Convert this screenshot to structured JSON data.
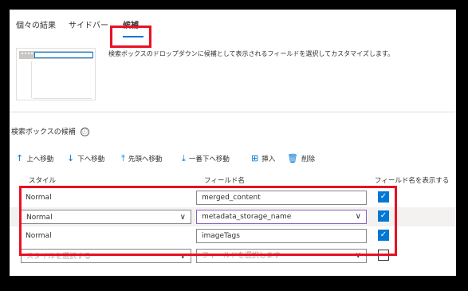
{
  "tabs": [
    "個々の結果",
    "サイドバー",
    "候補"
  ],
  "description": "検索ボックスのドロップダウンに候補として表示されるフィールドを選択してカスタマイズします。",
  "section_title": "検索ボックスの候補",
  "info_icon": "ⓘ",
  "toolbar": [
    {
      "icon": "↑",
      "label": "上へ移動",
      "icon_name": "arrow-up-icon"
    },
    {
      "icon": "↓",
      "label": "下へ移動",
      "icon_name": "arrow-down-icon"
    },
    {
      "icon": "⤒",
      "label": "先頭へ移動",
      "icon_name": "move-to-top-icon"
    },
    {
      "icon": "⤓",
      "label": "一番下へ移動",
      "icon_name": "move-to-bottom-icon"
    },
    {
      "icon": "⊞",
      "label": "挿入",
      "icon_name": "insert-icon"
    },
    {
      "icon": "🗑",
      "label": "削除",
      "icon_name": "delete-icon"
    }
  ],
  "columns": [
    "スタイル",
    "フィールド名",
    "フィールド名を表示する"
  ],
  "rows": [
    {
      "style": "Normal",
      "field": "merged_content",
      "show": true
    },
    {
      "style": "Normal",
      "field": "metadata_storage_name",
      "show": true
    },
    {
      "style": "Normal",
      "field": "imageTags",
      "show": true
    },
    {
      "style": "スタイルを選択する",
      "field": "フィールドを選択します",
      "show": false
    }
  ],
  "chevron": "∨",
  "check_mark": "✓",
  "colors": {
    "accent": "#0078d4",
    "highlight": "#e81123"
  }
}
